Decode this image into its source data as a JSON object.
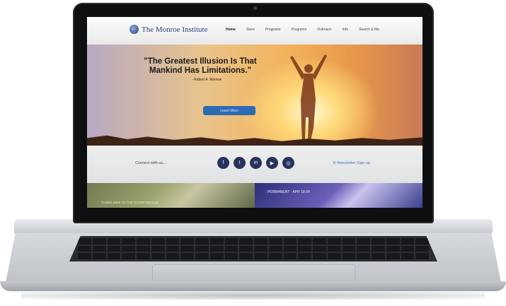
{
  "site": {
    "logo_text": "The Monroe Institute",
    "menu": [
      {
        "label": "Home",
        "active": true
      },
      {
        "label": "Store",
        "active": false
      },
      {
        "label": "Programs",
        "active": false
      },
      {
        "label": "Programs",
        "active": false
      },
      {
        "label": "Outreach",
        "active": false
      },
      {
        "label": "Info",
        "active": false
      },
      {
        "label": "Search & Me",
        "active": false
      }
    ]
  },
  "hero": {
    "quote": "\"The Greatest Illusion Is That Mankind Has Limitations.\"",
    "author": "- Robert A. Monroe",
    "button_label": "Learn More"
  },
  "connect": {
    "label": "Connect with us...",
    "social_icons": [
      {
        "name": "facebook-icon",
        "glyph": "f"
      },
      {
        "name": "twitter-icon",
        "glyph": "t"
      },
      {
        "name": "linkedin-icon",
        "glyph": "in"
      },
      {
        "name": "youtube-icon",
        "glyph": "▶"
      },
      {
        "name": "instagram-icon",
        "glyph": "◎"
      }
    ],
    "newsletter": "E-Newsletter Sign-up"
  },
  "tiles": {
    "left_caption": "GUIDELINES TO THE OUTER REALMS",
    "right_caption": "PERMANENT · APR 18-24"
  },
  "colors": {
    "brand_navy": "#27325e",
    "button_blue": "#2d6bb5",
    "link_blue": "#4b78b8"
  }
}
